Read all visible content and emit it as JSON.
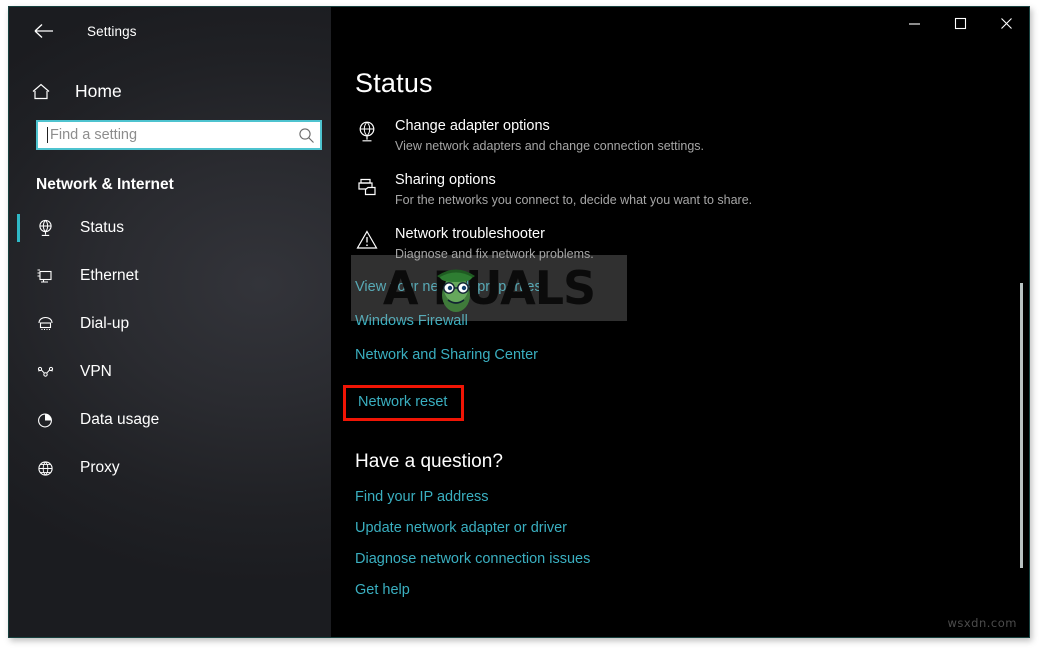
{
  "window": {
    "app_title": "Settings",
    "back_icon": "back-arrow-icon",
    "controls": {
      "minimize": "minimize-icon",
      "maximize": "maximize-icon",
      "close": "close-icon"
    }
  },
  "sidebar": {
    "home_label": "Home",
    "home_icon": "home-icon",
    "search": {
      "placeholder": "Find a setting",
      "value": "",
      "icon": "search-icon"
    },
    "category_title": "Network & Internet",
    "items": [
      {
        "label": "Status",
        "icon": "network-status-icon",
        "selected": true
      },
      {
        "label": "Ethernet",
        "icon": "ethernet-icon",
        "selected": false
      },
      {
        "label": "Dial-up",
        "icon": "dialup-modem-icon",
        "selected": false
      },
      {
        "label": "VPN",
        "icon": "vpn-key-icon",
        "selected": false
      },
      {
        "label": "Data usage",
        "icon": "pie-chart-icon",
        "selected": false
      },
      {
        "label": "Proxy",
        "icon": "globe-icon",
        "selected": false
      }
    ]
  },
  "main": {
    "page_title": "Status",
    "options": [
      {
        "title": "Change adapter options",
        "desc": "View network adapters and change connection settings.",
        "icon": "network-adapter-icon"
      },
      {
        "title": "Sharing options",
        "desc": "For the networks you connect to, decide what you want to share.",
        "icon": "sharing-printer-folder-icon"
      },
      {
        "title": "Network troubleshooter",
        "desc": "Diagnose and fix network problems.",
        "icon": "warning-triangle-icon"
      }
    ],
    "links": [
      "View your network properties",
      "Windows Firewall",
      "Network and Sharing Center"
    ],
    "highlighted_link": "Network reset",
    "question_title": "Have a question?",
    "help_links": [
      "Find your IP address",
      "Update network adapter or driver",
      "Diagnose network connection issues",
      "Get help"
    ]
  },
  "watermarks": {
    "brand_text": "A     PUALS",
    "site_text": "wsxdn.com"
  },
  "colors": {
    "accent": "#2fb8c6",
    "link": "#3aafc0",
    "highlight_box": "#f01505",
    "search_border": "#4ec3cf"
  }
}
